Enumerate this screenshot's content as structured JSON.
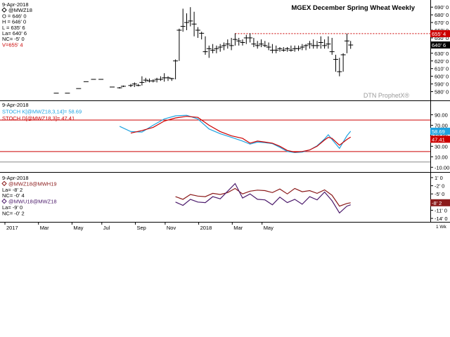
{
  "chart_data": [
    {
      "type": "ohlc",
      "title": "MGEX December Spring Wheat Weekly",
      "watermark": "DTN ProphetX®",
      "legend": [
        {
          "text": "9-Apr-2018"
        },
        {
          "text": "@MWZ18",
          "marker": "diamond"
        },
        {
          "text": "O = 646' 0"
        },
        {
          "text": "H = 646' 0"
        },
        {
          "text": "L = 635' 6"
        },
        {
          "text": "La= 640' 6"
        },
        {
          "text": "NC= -5' 0"
        },
        {
          "text": "V=655' 4",
          "color": "#cc0000"
        }
      ],
      "ylim": [
        575,
        692
      ],
      "yticks": [
        "580' 0",
        "590' 0",
        "600' 0",
        "610' 0",
        "620' 0",
        "630' 0",
        "640' 0",
        "650' 0",
        "660' 0",
        "670' 0",
        "680' 0",
        "690' 0"
      ],
      "ytick_values": [
        580,
        590,
        600,
        610,
        620,
        630,
        640,
        650,
        660,
        670,
        680,
        690
      ],
      "reference_line": {
        "value": 655.5,
        "from_week": 48,
        "color": "#cc0000",
        "label": "655' 4"
      },
      "last_label": {
        "value": 640.75,
        "label": "640' 6"
      },
      "bars": [
        {
          "w": 0,
          "h": 578,
          "l": 578,
          "c": 578
        },
        {
          "w": 3,
          "h": 578,
          "l": 578,
          "c": 578
        },
        {
          "w": 6,
          "h": 584,
          "l": 584,
          "c": 584
        },
        {
          "w": 8,
          "h": 593,
          "l": 593,
          "c": 593
        },
        {
          "w": 10,
          "h": 596,
          "l": 596,
          "c": 596
        },
        {
          "w": 12,
          "h": 596,
          "l": 596,
          "c": 596
        },
        {
          "w": 15,
          "h": 586,
          "l": 586,
          "c": 586
        },
        {
          "w": 17,
          "h": 586,
          "l": 584,
          "c": 585
        },
        {
          "w": 18,
          "h": 588,
          "l": 586,
          "c": 587
        },
        {
          "w": 20,
          "h": 590,
          "l": 586,
          "c": 588
        },
        {
          "w": 21,
          "h": 592,
          "l": 586,
          "c": 590
        },
        {
          "w": 22,
          "h": 590,
          "l": 587,
          "c": 588
        },
        {
          "w": 23,
          "h": 600,
          "l": 588,
          "c": 592
        },
        {
          "w": 24,
          "h": 598,
          "l": 592,
          "c": 595
        },
        {
          "w": 25,
          "h": 597,
          "l": 592,
          "c": 594
        },
        {
          "w": 26,
          "h": 596,
          "l": 592,
          "c": 594
        },
        {
          "w": 27,
          "h": 598,
          "l": 592,
          "c": 596
        },
        {
          "w": 28,
          "h": 600,
          "l": 594,
          "c": 596
        },
        {
          "w": 29,
          "h": 604,
          "l": 593,
          "c": 598
        },
        {
          "w": 30,
          "h": 600,
          "l": 594,
          "c": 598
        },
        {
          "w": 31,
          "h": 598,
          "l": 594,
          "c": 597
        },
        {
          "w": 32,
          "h": 622,
          "l": 596,
          "c": 620
        },
        {
          "w": 33,
          "h": 662,
          "l": 620,
          "c": 660
        },
        {
          "w": 34,
          "h": 688,
          "l": 658,
          "c": 665
        },
        {
          "w": 35,
          "h": 682,
          "l": 660,
          "c": 670
        },
        {
          "w": 36,
          "h": 690,
          "l": 665,
          "c": 672
        },
        {
          "w": 37,
          "h": 684,
          "l": 652,
          "c": 668
        },
        {
          "w": 38,
          "h": 664,
          "l": 650,
          "c": 660
        },
        {
          "w": 39,
          "h": 658,
          "l": 648,
          "c": 656
        },
        {
          "w": 40,
          "h": 652,
          "l": 628,
          "c": 632
        },
        {
          "w": 41,
          "h": 640,
          "l": 624,
          "c": 636
        },
        {
          "w": 42,
          "h": 642,
          "l": 630,
          "c": 634
        },
        {
          "w": 43,
          "h": 640,
          "l": 630,
          "c": 636
        },
        {
          "w": 44,
          "h": 642,
          "l": 632,
          "c": 638
        },
        {
          "w": 45,
          "h": 644,
          "l": 634,
          "c": 640
        },
        {
          "w": 46,
          "h": 648,
          "l": 636,
          "c": 642
        },
        {
          "w": 47,
          "h": 650,
          "l": 634,
          "c": 640
        },
        {
          "w": 48,
          "h": 656,
          "l": 640,
          "c": 648
        },
        {
          "w": 49,
          "h": 650,
          "l": 640,
          "c": 646
        },
        {
          "w": 50,
          "h": 648,
          "l": 640,
          "c": 644
        },
        {
          "w": 51,
          "h": 654,
          "l": 642,
          "c": 650
        },
        {
          "w": 52,
          "h": 656,
          "l": 644,
          "c": 650
        },
        {
          "w": 53,
          "h": 650,
          "l": 638,
          "c": 642
        },
        {
          "w": 54,
          "h": 646,
          "l": 636,
          "c": 640
        },
        {
          "w": 55,
          "h": 648,
          "l": 638,
          "c": 642
        },
        {
          "w": 56,
          "h": 646,
          "l": 638,
          "c": 640
        },
        {
          "w": 57,
          "h": 644,
          "l": 634,
          "c": 638
        },
        {
          "w": 58,
          "h": 642,
          "l": 630,
          "c": 634
        },
        {
          "w": 59,
          "h": 640,
          "l": 630,
          "c": 634
        },
        {
          "w": 60,
          "h": 638,
          "l": 632,
          "c": 636
        },
        {
          "w": 61,
          "h": 638,
          "l": 632,
          "c": 634
        },
        {
          "w": 62,
          "h": 638,
          "l": 632,
          "c": 636
        },
        {
          "w": 63,
          "h": 640,
          "l": 632,
          "c": 634
        },
        {
          "w": 64,
          "h": 640,
          "l": 632,
          "c": 636
        },
        {
          "w": 65,
          "h": 640,
          "l": 633,
          "c": 636
        },
        {
          "w": 66,
          "h": 642,
          "l": 634,
          "c": 638
        },
        {
          "w": 67,
          "h": 642,
          "l": 634,
          "c": 640
        },
        {
          "w": 68,
          "h": 646,
          "l": 636,
          "c": 642
        },
        {
          "w": 69,
          "h": 648,
          "l": 636,
          "c": 640
        },
        {
          "w": 70,
          "h": 646,
          "l": 636,
          "c": 640
        },
        {
          "w": 71,
          "h": 652,
          "l": 636,
          "c": 644
        },
        {
          "w": 72,
          "h": 648,
          "l": 636,
          "c": 640
        },
        {
          "w": 73,
          "h": 652,
          "l": 636,
          "c": 642
        },
        {
          "w": 74,
          "h": 650,
          "l": 628,
          "c": 632
        },
        {
          "w": 75,
          "h": 628,
          "l": 606,
          "c": 622
        },
        {
          "w": 76,
          "h": 624,
          "l": 600,
          "c": 606
        },
        {
          "w": 77,
          "h": 630,
          "l": 606,
          "c": 628
        },
        {
          "w": 78,
          "h": 655.5,
          "l": 630,
          "c": 646
        },
        {
          "w": 79,
          "h": 646,
          "l": 635.75,
          "c": 640.75
        }
      ]
    },
    {
      "type": "line",
      "legend": [
        {
          "text": "9-Apr-2018"
        },
        {
          "text": "STOCH K[@MWZ18,3,14]= 58.69",
          "color": "#1fa3e0"
        },
        {
          "text": "STOCH D[@MWZ18,3]= 47.41",
          "color": "#cc0000"
        }
      ],
      "ylim": [
        -15,
        108
      ],
      "yticks": [
        "-10.00",
        "10.00",
        "30.00",
        "50.00",
        "70.00",
        "90.00"
      ],
      "ytick_values": [
        -10,
        10,
        30,
        50,
        70,
        90
      ],
      "hlines": [
        {
          "value": 80,
          "color": "#cc0000"
        },
        {
          "value": 20,
          "color": "#cc0000"
        },
        {
          "value": 0,
          "color": "#888888"
        }
      ],
      "last_labels": [
        {
          "value": 58.69,
          "label": "58.69",
          "color": "#1fa3e0"
        },
        {
          "value": 47.41,
          "label": "47.41",
          "color": "#cc0000"
        }
      ],
      "series": [
        {
          "name": "STOCH K[@MWZ18,3,14]",
          "color": "#1fa3e0",
          "x": [
            17,
            20,
            23,
            26,
            29,
            32,
            35,
            38,
            41,
            44,
            47,
            50,
            52,
            54,
            56,
            58,
            60,
            62,
            64,
            66,
            68,
            70,
            72,
            73,
            74,
            76,
            78,
            79
          ],
          "y": [
            68,
            58,
            57,
            70,
            82,
            88,
            89,
            82,
            63,
            54,
            47,
            40,
            34,
            38,
            37,
            35,
            28,
            20,
            18,
            19,
            23,
            31,
            44,
            52,
            43,
            26,
            50,
            58.69
          ]
        },
        {
          "name": "STOCH D[@MWZ18,3]",
          "color": "#cc0000",
          "x": [
            20,
            23,
            26,
            29,
            32,
            35,
            38,
            41,
            44,
            47,
            50,
            52,
            54,
            56,
            58,
            60,
            62,
            64,
            66,
            68,
            70,
            72,
            73,
            74,
            76,
            78,
            79
          ],
          "y": [
            55,
            60,
            66,
            78,
            84,
            87,
            85,
            70,
            58,
            50,
            45,
            36,
            40,
            38,
            36,
            30,
            22,
            19,
            20,
            23,
            30,
            42,
            47,
            45,
            32,
            43,
            47.41
          ]
        }
      ]
    },
    {
      "type": "line",
      "legend": [
        {
          "text": "9-Apr-2018"
        },
        {
          "text": "@MWZ18@MWH19",
          "color": "#8b1a1a",
          "marker": "diamond"
        },
        {
          "text": "La= -8' 2"
        },
        {
          "text": "NC= -0' 4"
        },
        {
          "text": "@MWU18@MWZ18",
          "color": "#4b1a6b",
          "marker": "diamond"
        },
        {
          "text": "La= -9' 0"
        },
        {
          "text": "NC= -0' 2"
        }
      ],
      "ylim": [
        -14.5,
        1.5
      ],
      "yticks": [
        "-14' 0",
        "-11' 0",
        "-8' 0",
        "-5' 0",
        "-2' 0",
        "1' 0"
      ],
      "ytick_values": [
        -14,
        -11,
        -8,
        -5,
        -2,
        1
      ],
      "last_label": {
        "value": -8.25,
        "label": "-8' 2"
      },
      "series": [
        {
          "name": "@MWZ18@MWH19",
          "color": "#8b1a1a",
          "x": [
            32,
            34,
            36,
            38,
            40,
            42,
            44,
            46,
            48,
            50,
            52,
            54,
            56,
            58,
            60,
            62,
            64,
            66,
            68,
            70,
            72,
            74,
            76,
            78,
            79
          ],
          "y": [
            -6,
            -7,
            -5.2,
            -5.8,
            -6,
            -4.8,
            -5.2,
            -4.5,
            -3,
            -5,
            -4,
            -3.6,
            -3.8,
            -4.5,
            -3.2,
            -5,
            -3,
            -4.2,
            -3.8,
            -4.8,
            -3.5,
            -5.5,
            -9.5,
            -8.5,
            -8.25
          ]
        },
        {
          "name": "@MWU18@MWZ18",
          "color": "#4b1a6b",
          "x": [
            32,
            34,
            36,
            38,
            40,
            42,
            44,
            46,
            48,
            50,
            52,
            54,
            56,
            58,
            60,
            62,
            64,
            66,
            68,
            70,
            72,
            74,
            76,
            78,
            79
          ],
          "y": [
            -8,
            -9.2,
            -7,
            -8,
            -8.2,
            -6,
            -6.8,
            -4,
            -1.2,
            -6.5,
            -5,
            -7,
            -7.2,
            -9,
            -6.2,
            -8.2,
            -7,
            -8.8,
            -6,
            -7.2,
            -4.3,
            -7.5,
            -12,
            -9.5,
            -9
          ]
        }
      ],
      "x_axis": {
        "labels": [
          {
            "w": 0,
            "text": "2017"
          },
          {
            "w": 9,
            "text": "Mar"
          },
          {
            "w": 18,
            "text": "May"
          },
          {
            "w": 26,
            "text": "Jul"
          },
          {
            "w": 35,
            "text": "Sep"
          },
          {
            "w": 43,
            "text": "Nov"
          },
          {
            "w": 52,
            "text": "2018"
          },
          {
            "w": 61,
            "text": "Mar"
          },
          {
            "w": 69,
            "text": "May"
          }
        ],
        "timeframe_label": "1 Wk"
      }
    }
  ]
}
